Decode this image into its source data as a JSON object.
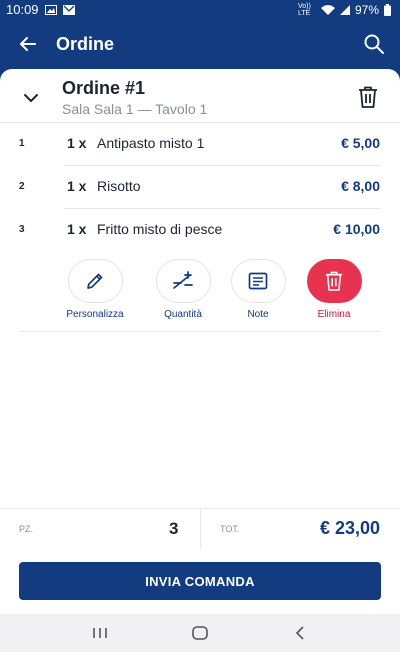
{
  "status_bar": {
    "time": "10:09",
    "network": "Vo)) LTE",
    "battery": "97%"
  },
  "app_bar": {
    "title": "Ordine",
    "back_icon": "arrow-left-icon",
    "search_icon": "search-icon"
  },
  "order": {
    "title": "Ordine #1",
    "subtitle": "Sala Sala 1 — Tavolo 1",
    "items": [
      {
        "index": "1",
        "qty": "1 x",
        "name": "Antipasto misto 1",
        "price": "€ 5,00"
      },
      {
        "index": "2",
        "qty": "1 x",
        "name": "Risotto",
        "price": "€ 8,00"
      },
      {
        "index": "3",
        "qty": "1 x",
        "name": "Fritto misto di pesce",
        "price": "€ 10,00"
      }
    ]
  },
  "actions": {
    "customize": "Personalizza",
    "quantity": "Quantità",
    "notes": "Note",
    "delete": "Elimina"
  },
  "totals": {
    "pz_label": "PZ.",
    "pz_value": "3",
    "tot_label": "TOT.",
    "tot_value": "€ 23,00"
  },
  "send_button": "INVIA COMANDA",
  "colors": {
    "primary": "#123b80",
    "danger": "#e8324f",
    "divider": "#e6e7ea"
  }
}
